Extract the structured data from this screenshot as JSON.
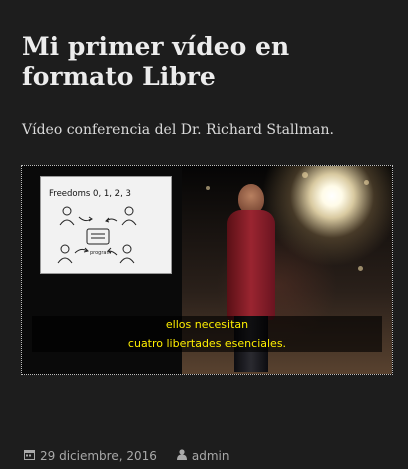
{
  "post": {
    "title": "Mi primer vídeo en formato Libre",
    "excerpt": "Vídeo conferencia del Dr. Richard Stallman."
  },
  "video": {
    "slide_title": "Freedoms 0, 1, 2, 3",
    "slide_label": "program",
    "subtitles": [
      "ellos necesitan",
      "cuatro libertades esenciales."
    ],
    "subtitle_color": "#ffef00"
  },
  "meta": {
    "date": "29 diciembre, 2016",
    "author": "admin",
    "date_icon": "calendar-icon",
    "author_icon": "user-icon"
  },
  "colors": {
    "background": "#1d1d1d",
    "title": "#ececec",
    "meta_text": "#a9a9a9"
  }
}
